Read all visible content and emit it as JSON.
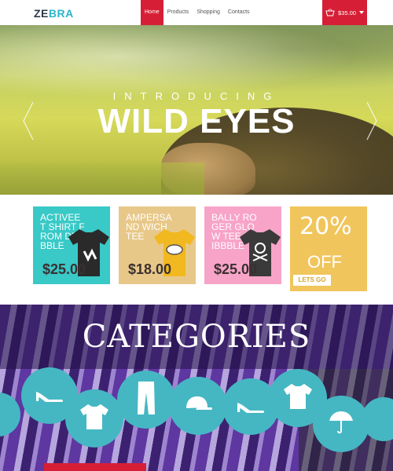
{
  "brand": {
    "part1": "ZE",
    "part2": "BRA"
  },
  "nav": {
    "items": [
      "Home",
      "Products",
      "Shopping",
      "Contacts"
    ],
    "active_index": 0
  },
  "cart": {
    "total": "$35.00",
    "icon": "basket-icon"
  },
  "hero": {
    "intro": "INTRODUCING",
    "title": "WILD EYES",
    "prev_icon": "chevron-left-icon",
    "next_icon": "chevron-right-icon"
  },
  "products": [
    {
      "name": "ACTIVEE T SHIRT FROM DRIBBBLE",
      "price": "$25.00",
      "color": "#39c9c7",
      "shirt_color": "#2a2a2a"
    },
    {
      "name": "AMPERSAND WICH TEE",
      "price": "$18.00",
      "color": "#e8c889",
      "shirt_color": "#f1b81f"
    },
    {
      "name": "BALLY ROGER GLOW TEE DRIBBBLE",
      "price": "$25.00",
      "color": "#f7a4c8",
      "shirt_color": "#3a3a3a"
    }
  ],
  "promo": {
    "percent": "20%",
    "off": "OFF",
    "cta": "LETS GO",
    "color": "#f0c55c"
  },
  "categories": {
    "heading": "CATEGORIES",
    "icons": [
      "high-heel-icon",
      "tshirt-icon",
      "pants-icon",
      "cap-icon",
      "high-heel-icon",
      "tshirt-icon",
      "umbrella-icon"
    ]
  },
  "colors": {
    "accent": "#d61f36",
    "teal": "#45b7c3"
  }
}
